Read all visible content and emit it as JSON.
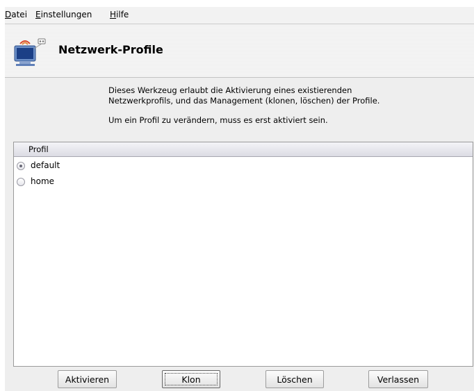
{
  "menubar": {
    "items": [
      {
        "prefix": "",
        "mnemonic": "D",
        "rest": "atei"
      },
      {
        "prefix": "",
        "mnemonic": "E",
        "rest": "instellungen"
      },
      {
        "prefix": "",
        "mnemonic": "H",
        "rest": "ilfe"
      }
    ]
  },
  "header": {
    "title": "Netzwerk-Profile",
    "icon": "network-computer-icon"
  },
  "description": {
    "paragraph1": "Dieses Werkzeug erlaubt die Aktivierung eines existierenden Netzwerkprofils, und das Management (klonen, löschen) der Profile.",
    "paragraph2": "Um ein Profil zu verändern, muss es erst aktiviert sein."
  },
  "profile_list": {
    "column_header": "Profil",
    "rows": [
      {
        "label": "default",
        "selected": true
      },
      {
        "label": "home",
        "selected": false
      }
    ]
  },
  "buttons": {
    "activate": "Aktivieren",
    "clone": "Klon",
    "delete": "Löschen",
    "quit": "Verlassen"
  }
}
